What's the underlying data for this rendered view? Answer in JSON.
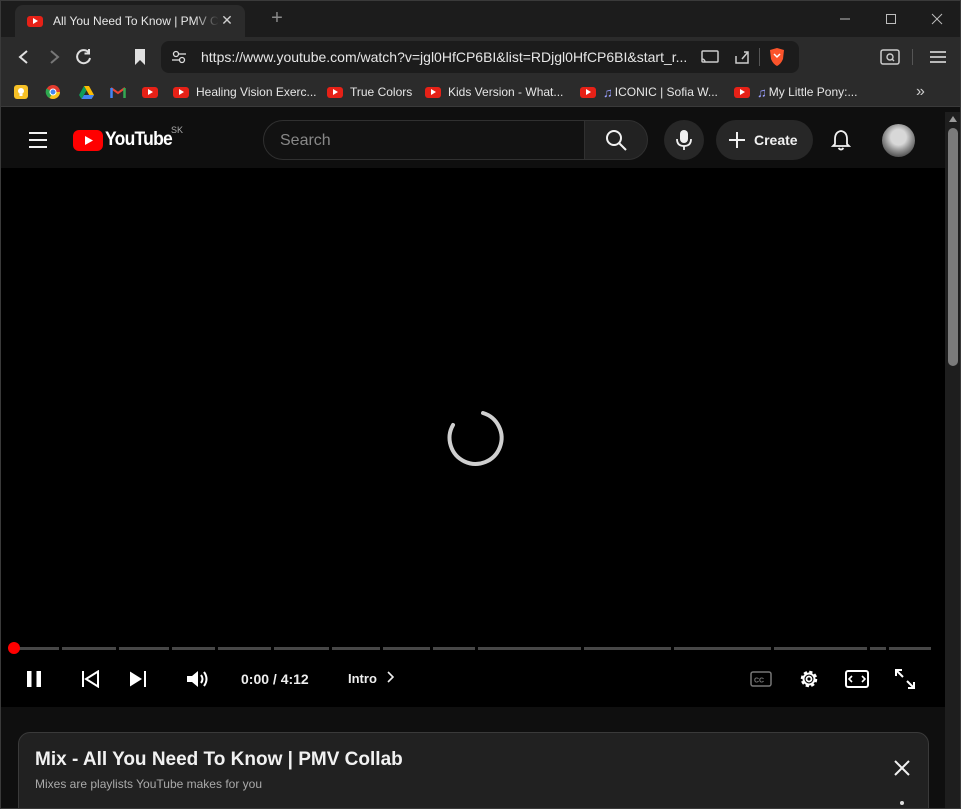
{
  "browser": {
    "tab": {
      "title": "All You Need To Know | PMV Collab"
    },
    "url": "https://www.youtube.com/watch?v=jgl0HfCP6BI&list=RDjgl0HfCP6BI&start_r...",
    "bookmarks": [
      {
        "label": "Healing Vision Exerc...",
        "icon": "youtube-icon"
      },
      {
        "label": "True Colors",
        "icon": "youtube-icon"
      },
      {
        "label": "Kids Version - What...",
        "icon": "youtube-icon"
      },
      {
        "label": "ICONIC | Sofia W...",
        "icon": "music-note-icon"
      },
      {
        "label": "My Little Pony:...",
        "icon": "music-note-icon"
      }
    ]
  },
  "youtube": {
    "logo_text": "YouTube",
    "country": "SK",
    "search_placeholder": "Search",
    "create_label": "Create"
  },
  "player": {
    "time": "0:00 / 4:12",
    "chapter": "Intro",
    "progress_fraction": 0,
    "state": "loading"
  },
  "mix": {
    "title": "Mix - All You Need To Know | PMV Collab",
    "subtitle": "Mixes are playlists YouTube makes for you"
  },
  "colors": {
    "accent": "#ff0000",
    "background": "#0f0f0f",
    "player": "#000000"
  }
}
